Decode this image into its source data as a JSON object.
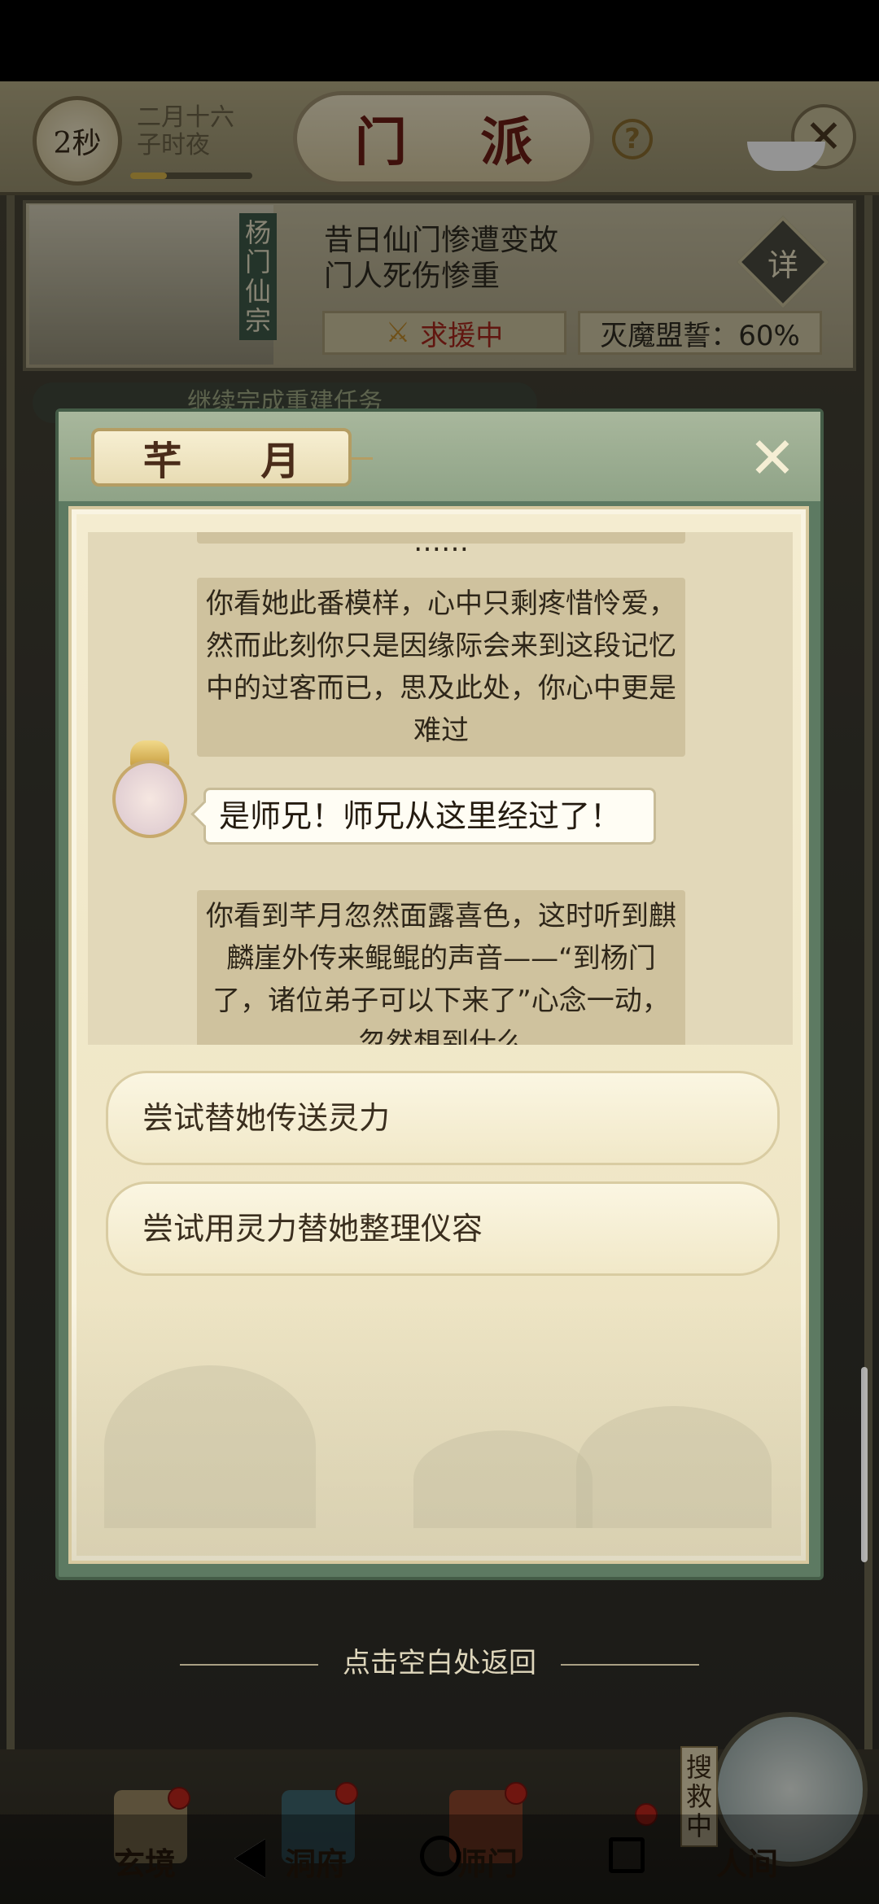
{
  "header": {
    "timer": "2秒",
    "date_line1": "二月十六",
    "date_line2": "子时夜",
    "time_progress": 0.3,
    "title": "门 派",
    "help": "?"
  },
  "sect": {
    "name": "杨门仙宗",
    "desc_line1": "昔日仙门惨遭变故",
    "desc_line2": "门人死伤惨重",
    "detail_button": "详",
    "help_button": "求援中",
    "pledge": "灭魔盟誓：60%",
    "task_hint": "继续完成重建任务"
  },
  "dialog": {
    "title": "芊 月",
    "close_label": "✕",
    "story": {
      "bubble_top": "……",
      "bubble_1": "你看她此番模样，心中只剩疼惜怜爱，然而此刻你只是因缘际会来到这段记忆中的过客而已，思及此处，你心中更是难过",
      "speech": "是师兄！师兄从这里经过了！",
      "bubble_3": "你看到芊月忽然面露喜色，这时听到麒麟崖外传来鲲鲲的声音——“到杨门了，诸位弟子可以下来了”心念一动，忽然想到什么"
    },
    "choices": [
      {
        "label": "尝试替她传送灵力"
      },
      {
        "label": "尝试用灵力替她整理仪容"
      }
    ]
  },
  "return_hint": "点击空白处返回",
  "nav": {
    "items": [
      {
        "label": "玄境"
      },
      {
        "label": "洞府"
      },
      {
        "label": "师门"
      },
      {
        "label": ""
      },
      {
        "label": "人间"
      }
    ],
    "rescue_badge": "搜救中"
  }
}
